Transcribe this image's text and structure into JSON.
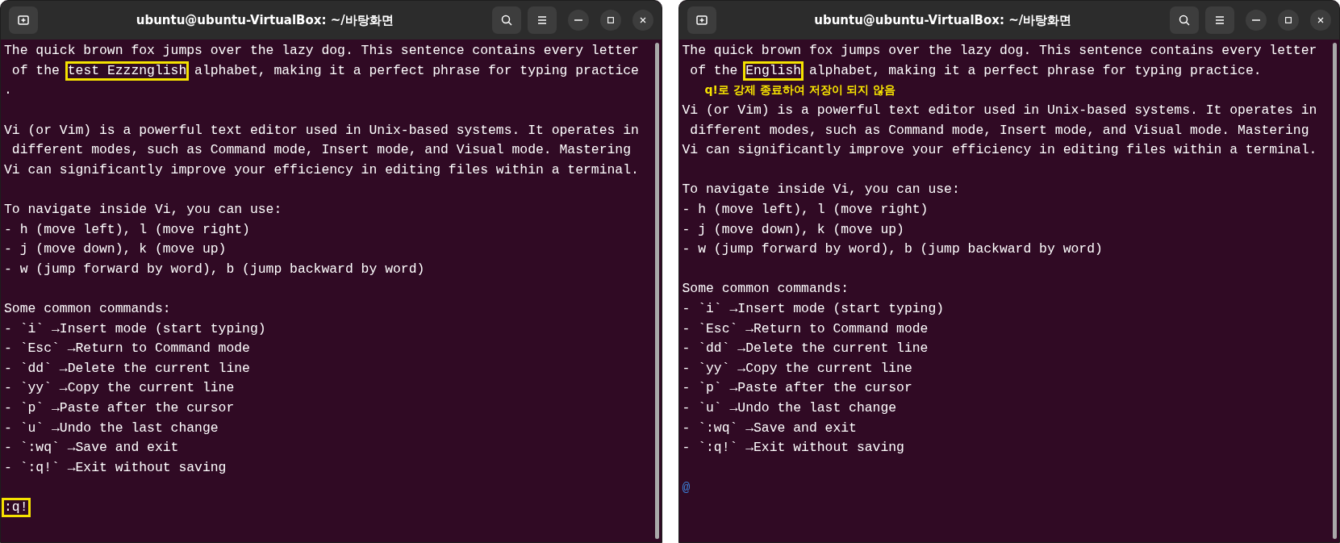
{
  "windows": [
    {
      "title": "ubuntu@ubuntu-VirtualBox: ~/바탕화면",
      "lines": [
        {
          "kind": "text",
          "segments": [
            {
              "text": "The quick brown fox jumps over the lazy dog. This sentence contains every letter",
              "highlighted": false
            }
          ]
        },
        {
          "kind": "text",
          "segments": [
            {
              "text": " of the ",
              "highlighted": false
            },
            {
              "text": "test Ezzznglish",
              "highlighted": true
            },
            {
              "text": " alphabet, making it a perfect phrase for typing practice",
              "highlighted": false
            }
          ]
        },
        {
          "kind": "text",
          "segments": [
            {
              "text": ".",
              "highlighted": false
            }
          ]
        },
        {
          "kind": "blank"
        },
        {
          "kind": "text",
          "segments": [
            {
              "text": "Vi (or Vim) is a powerful text editor used in Unix-based systems. It operates in",
              "highlighted": false
            }
          ]
        },
        {
          "kind": "text",
          "segments": [
            {
              "text": " different modes, such as Command mode, Insert mode, and Visual mode. Mastering",
              "highlighted": false
            }
          ]
        },
        {
          "kind": "text",
          "segments": [
            {
              "text": "Vi can significantly improve your efficiency in editing files within a terminal.",
              "highlighted": false
            }
          ]
        },
        {
          "kind": "blank"
        },
        {
          "kind": "text",
          "segments": [
            {
              "text": "To navigate inside Vi, you can use:",
              "highlighted": false
            }
          ]
        },
        {
          "kind": "text",
          "segments": [
            {
              "text": "- h (move left), l (move right)",
              "highlighted": false
            }
          ]
        },
        {
          "kind": "text",
          "segments": [
            {
              "text": "- j (move down), k (move up)",
              "highlighted": false
            }
          ]
        },
        {
          "kind": "text",
          "segments": [
            {
              "text": "- w (jump forward by word), b (jump backward by word)",
              "highlighted": false
            }
          ]
        },
        {
          "kind": "blank"
        },
        {
          "kind": "text",
          "segments": [
            {
              "text": "Some common commands:",
              "highlighted": false
            }
          ]
        },
        {
          "kind": "text",
          "segments": [
            {
              "text": "- `i` →Insert mode (start typing)",
              "highlighted": false
            }
          ]
        },
        {
          "kind": "text",
          "segments": [
            {
              "text": "- `Esc` →Return to Command mode",
              "highlighted": false
            }
          ]
        },
        {
          "kind": "text",
          "segments": [
            {
              "text": "- `dd` →Delete the current line",
              "highlighted": false
            }
          ]
        },
        {
          "kind": "text",
          "segments": [
            {
              "text": "- `yy` →Copy the current line",
              "highlighted": false
            }
          ]
        },
        {
          "kind": "text",
          "segments": [
            {
              "text": "- `p` →Paste after the cursor",
              "highlighted": false
            }
          ]
        },
        {
          "kind": "text",
          "segments": [
            {
              "text": "- `u` →Undo the last change",
              "highlighted": false
            }
          ]
        },
        {
          "kind": "text",
          "segments": [
            {
              "text": "- `:wq` →Save and exit",
              "highlighted": false
            }
          ]
        },
        {
          "kind": "text",
          "segments": [
            {
              "text": "- `:q!` →Exit without saving",
              "highlighted": false
            }
          ]
        },
        {
          "kind": "blank"
        },
        {
          "kind": "text",
          "segments": [
            {
              "text": ":q!",
              "highlighted": true
            }
          ]
        }
      ]
    },
    {
      "title": "ubuntu@ubuntu-VirtualBox: ~/바탕화면",
      "lines": [
        {
          "kind": "text",
          "segments": [
            {
              "text": "The quick brown fox jumps over the lazy dog. This sentence contains every letter",
              "highlighted": false
            }
          ]
        },
        {
          "kind": "text",
          "segments": [
            {
              "text": " of the ",
              "highlighted": false
            },
            {
              "text": "English",
              "highlighted": true
            },
            {
              "text": " alphabet, making it a perfect phrase for typing practice.",
              "highlighted": false
            }
          ]
        },
        {
          "kind": "annotation",
          "text": "q!로 강제 종료하여 저장이 되지 않음"
        },
        {
          "kind": "text",
          "segments": [
            {
              "text": "Vi (or Vim) is a powerful text editor used in Unix-based systems. It operates in",
              "highlighted": false
            }
          ]
        },
        {
          "kind": "text",
          "segments": [
            {
              "text": " different modes, such as Command mode, Insert mode, and Visual mode. Mastering",
              "highlighted": false
            }
          ]
        },
        {
          "kind": "text",
          "segments": [
            {
              "text": "Vi can significantly improve your efficiency in editing files within a terminal.",
              "highlighted": false
            }
          ]
        },
        {
          "kind": "blank"
        },
        {
          "kind": "text",
          "segments": [
            {
              "text": "To navigate inside Vi, you can use:",
              "highlighted": false
            }
          ]
        },
        {
          "kind": "text",
          "segments": [
            {
              "text": "- h (move left), l (move right)",
              "highlighted": false
            }
          ]
        },
        {
          "kind": "text",
          "segments": [
            {
              "text": "- j (move down), k (move up)",
              "highlighted": false
            }
          ]
        },
        {
          "kind": "text",
          "segments": [
            {
              "text": "- w (jump forward by word), b (jump backward by word)",
              "highlighted": false
            }
          ]
        },
        {
          "kind": "blank"
        },
        {
          "kind": "text",
          "segments": [
            {
              "text": "Some common commands:",
              "highlighted": false
            }
          ]
        },
        {
          "kind": "text",
          "segments": [
            {
              "text": "- `i` →Insert mode (start typing)",
              "highlighted": false
            }
          ]
        },
        {
          "kind": "text",
          "segments": [
            {
              "text": "- `Esc` →Return to Command mode",
              "highlighted": false
            }
          ]
        },
        {
          "kind": "text",
          "segments": [
            {
              "text": "- `dd` →Delete the current line",
              "highlighted": false
            }
          ]
        },
        {
          "kind": "text",
          "segments": [
            {
              "text": "- `yy` →Copy the current line",
              "highlighted": false
            }
          ]
        },
        {
          "kind": "text",
          "segments": [
            {
              "text": "- `p` →Paste after the cursor",
              "highlighted": false
            }
          ]
        },
        {
          "kind": "text",
          "segments": [
            {
              "text": "- `u` →Undo the last change",
              "highlighted": false
            }
          ]
        },
        {
          "kind": "text",
          "segments": [
            {
              "text": "- `:wq` →Save and exit",
              "highlighted": false
            }
          ]
        },
        {
          "kind": "text",
          "segments": [
            {
              "text": "- `:q!` →Exit without saving",
              "highlighted": false
            }
          ]
        },
        {
          "kind": "blank"
        },
        {
          "kind": "filler",
          "text": "@"
        }
      ]
    }
  ]
}
